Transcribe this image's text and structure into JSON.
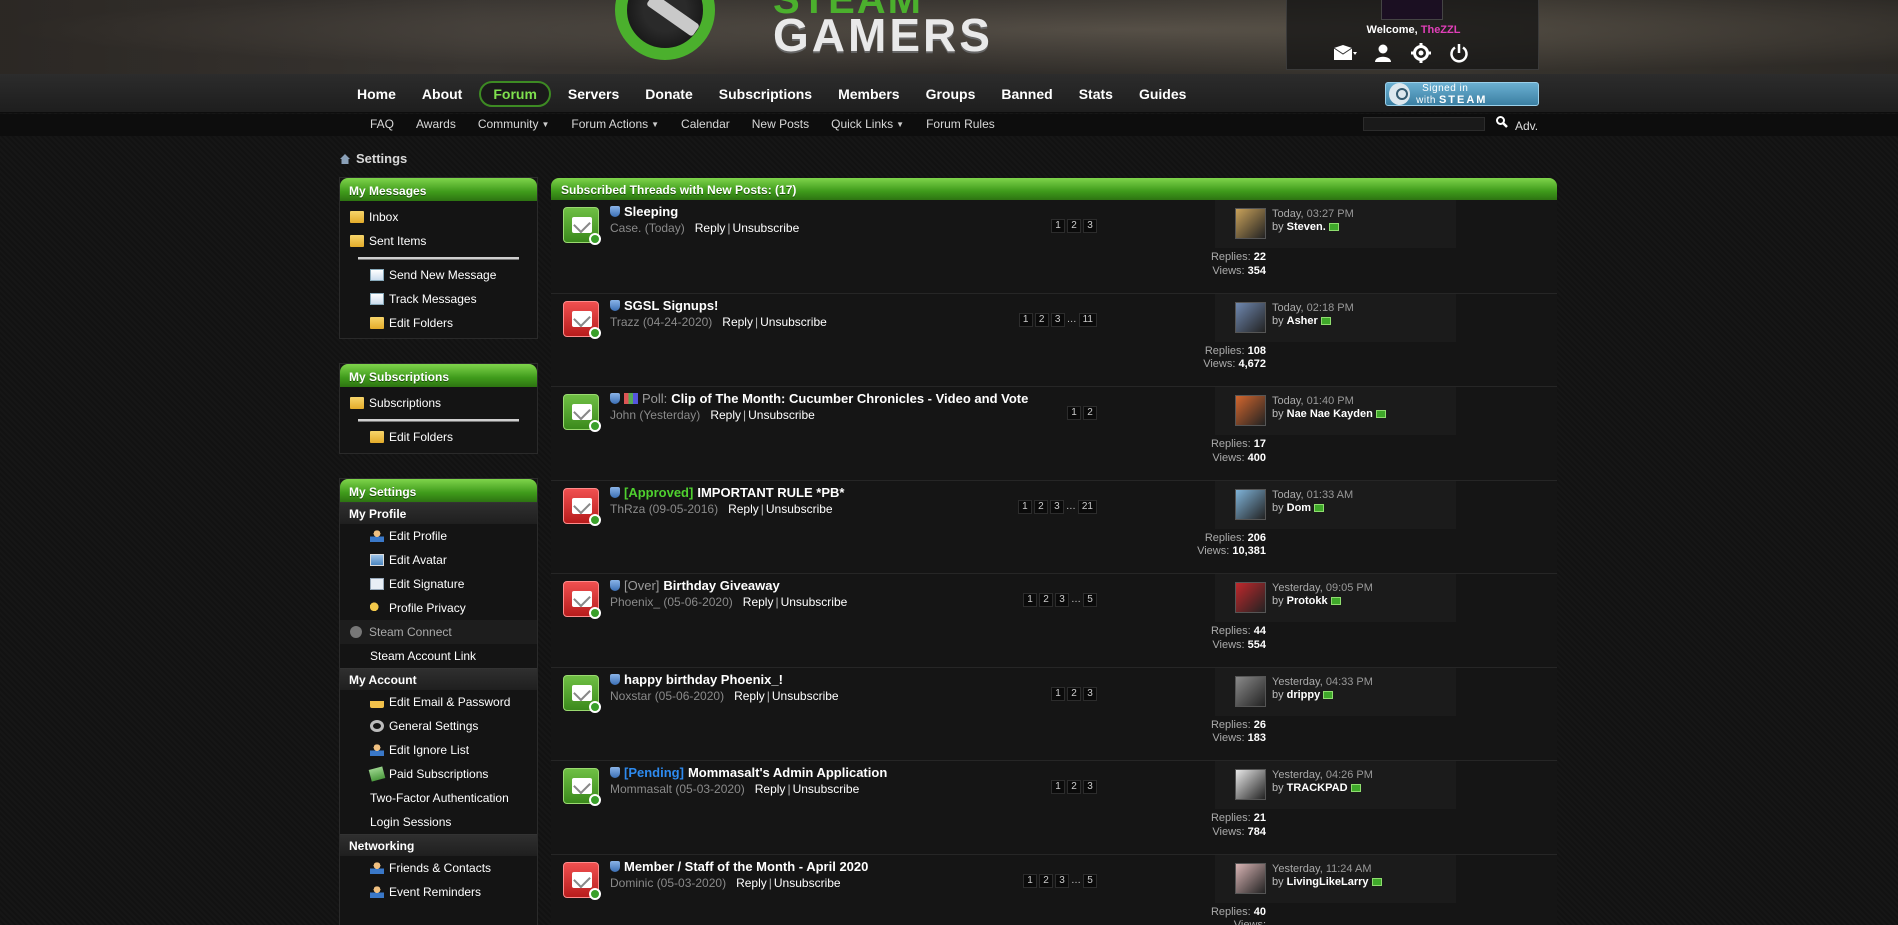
{
  "header": {
    "logo_top": "STEAM",
    "logo_text": "GAMERS",
    "welcome_prefix": "Welcome,",
    "username": "TheZZL",
    "steam_signin": "Signed in with",
    "steam_word": "STEAM"
  },
  "main_nav": [
    "Home",
    "About",
    "Forum",
    "Servers",
    "Donate",
    "Subscriptions",
    "Members",
    "Groups",
    "Banned",
    "Stats",
    "Guides"
  ],
  "sub_nav": [
    {
      "label": "FAQ",
      "dropdown": false
    },
    {
      "label": "Awards",
      "dropdown": false
    },
    {
      "label": "Community",
      "dropdown": true
    },
    {
      "label": "Forum Actions",
      "dropdown": true
    },
    {
      "label": "Calendar",
      "dropdown": false
    },
    {
      "label": "New Posts",
      "dropdown": false
    },
    {
      "label": "Quick Links",
      "dropdown": true
    },
    {
      "label": "Forum Rules",
      "dropdown": false
    }
  ],
  "search": {
    "adv": "Adv."
  },
  "breadcrumb": {
    "title": "Settings"
  },
  "sidebar": {
    "messages": {
      "title": "My Messages",
      "inbox": "Inbox",
      "sent": "Sent Items",
      "send_new": "Send New Message",
      "track": "Track Messages",
      "edit_folders": "Edit Folders"
    },
    "subscriptions": {
      "title": "My Subscriptions",
      "subscriptions": "Subscriptions",
      "edit_folders": "Edit Folders"
    },
    "settings": {
      "title": "My Settings",
      "profile_section": "My Profile",
      "edit_profile": "Edit Profile",
      "edit_avatar": "Edit Avatar",
      "edit_signature": "Edit Signature",
      "profile_privacy": "Profile Privacy",
      "steam_connect": "Steam Connect",
      "steam_account_link": "Steam Account Link",
      "account_section": "My Account",
      "edit_email": "Edit Email & Password",
      "general_settings": "General Settings",
      "edit_ignore": "Edit Ignore List",
      "paid_subs": "Paid Subscriptions",
      "two_factor": "Two-Factor Authentication",
      "login_sessions": "Login Sessions",
      "networking_section": "Networking",
      "friends": "Friends & Contacts",
      "event_reminders": "Event Reminders"
    }
  },
  "threads": {
    "heading": "Subscribed Threads with New Posts: (17)",
    "reply_label": "Reply",
    "unsubscribe_label": "Unsubscribe",
    "by_label": "by",
    "replies_label": "Replies:",
    "views_label": "Views:",
    "rows": [
      {
        "status": "green",
        "prefix": "",
        "title": "Sleeping",
        "author": "Case.",
        "date": "(Today)",
        "pages": [
          "1",
          "2",
          "3"
        ],
        "lp_day": "Today,",
        "lp_time": "03:27 PM",
        "lp_user": "Steven.",
        "replies": "22",
        "views": "354",
        "avatar_color": "#c9a25a"
      },
      {
        "status": "red",
        "prefix": "",
        "title": "SGSL Signups!",
        "author": "Trazz",
        "date": "(04-24-2020)",
        "pages": [
          "1",
          "2",
          "3",
          "…",
          "11"
        ],
        "lp_day": "Today,",
        "lp_time": "02:18 PM",
        "lp_user": "Asher",
        "replies": "108",
        "views": "4,672",
        "avatar_color": "#6f88b0"
      },
      {
        "status": "green",
        "prefix": "Poll:",
        "prefix_type": "poll",
        "title": "Clip of The Month: Cucumber Chronicles - Video and Vote",
        "author": "John",
        "date": "(Yesterday)",
        "pages": [
          "1",
          "2"
        ],
        "lp_day": "Today,",
        "lp_time": "01:40 PM",
        "lp_user": "Nae Nae Kayden",
        "replies": "17",
        "views": "400",
        "avatar_color": "#d2662e"
      },
      {
        "status": "red",
        "prefix": "[Approved]",
        "prefix_type": "approved",
        "title": "IMPORTANT RULE *PB*",
        "author": "ThRza",
        "date": "(09-05-2016)",
        "pages": [
          "1",
          "2",
          "3",
          "…",
          "21"
        ],
        "lp_day": "Today,",
        "lp_time": "01:33 AM",
        "lp_user": "Dom",
        "replies": "206",
        "views": "10,381",
        "avatar_color": "#7fb3d8"
      },
      {
        "status": "red",
        "prefix": "[Over]",
        "prefix_type": "over",
        "title": "Birthday Giveaway",
        "author": "Phoenix_",
        "date": "(05-06-2020)",
        "pages": [
          "1",
          "2",
          "3",
          "…",
          "5"
        ],
        "lp_day": "Yesterday,",
        "lp_time": "09:05 PM",
        "lp_user": "Protokk",
        "replies": "44",
        "views": "554",
        "avatar_color": "#c0282c"
      },
      {
        "status": "green",
        "prefix": "",
        "title": "happy birthday Phoenix_!",
        "author": "Noxstar",
        "date": "(05-06-2020)",
        "pages": [
          "1",
          "2",
          "3"
        ],
        "lp_day": "Yesterday,",
        "lp_time": "04:33 PM",
        "lp_user": "drippy",
        "replies": "26",
        "views": "183",
        "avatar_color": "#8a8a8a"
      },
      {
        "status": "green",
        "prefix": "[Pending]",
        "prefix_type": "pending",
        "title": "Mommasalt's Admin Application",
        "author": "Mommasalt",
        "date": "(05-03-2020)",
        "pages": [
          "1",
          "2",
          "3"
        ],
        "lp_day": "Yesterday,",
        "lp_time": "04:26 PM",
        "lp_user": "TRACKPAD",
        "replies": "21",
        "views": "784",
        "avatar_color": "#e8e8e8"
      },
      {
        "status": "red",
        "prefix": "",
        "title": "Member / Staff of the Month - April 2020",
        "author": "Dominic",
        "date": "(05-03-2020)",
        "pages": [
          "1",
          "2",
          "3",
          "…",
          "5"
        ],
        "lp_day": "Yesterday,",
        "lp_time": "11:24 AM",
        "lp_user": "LivingLikeLarry",
        "replies": "40",
        "views": "",
        "avatar_color": "#d8b4b4"
      }
    ]
  }
}
